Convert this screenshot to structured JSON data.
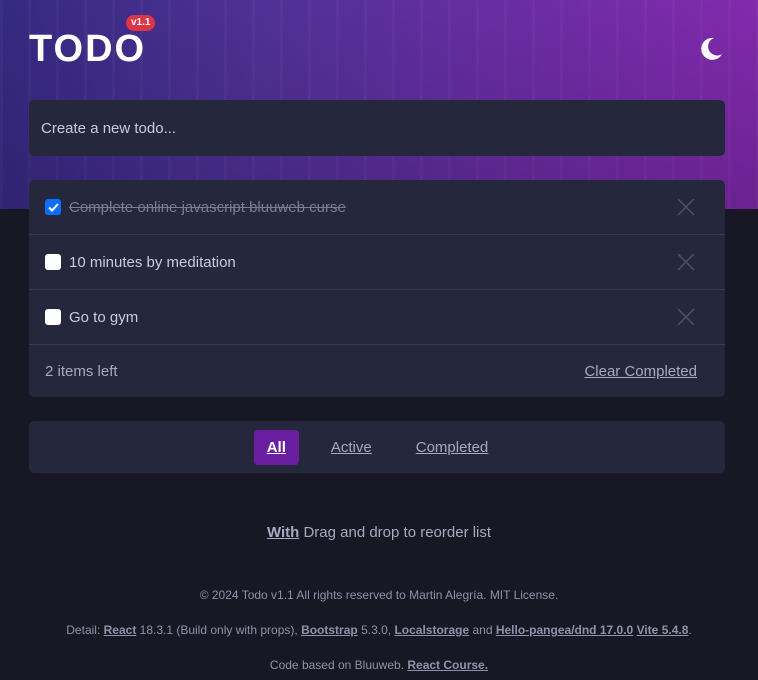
{
  "header": {
    "title": "TODO",
    "version_badge": "v1.1",
    "theme_icon": "moon-icon"
  },
  "new_todo": {
    "placeholder": "Create a new todo..."
  },
  "todos": [
    {
      "text": "Complete online javascript bluuweb curse",
      "completed": true
    },
    {
      "text": "10 minutes by meditation",
      "completed": false
    },
    {
      "text": "Go to gym",
      "completed": false
    }
  ],
  "list_footer": {
    "items_left": "2 items left",
    "clear_completed": "Clear Completed"
  },
  "filters": {
    "all": "All",
    "active": "Active",
    "completed": "Completed",
    "selected": "All"
  },
  "dnd_note": {
    "with": "With",
    "text": " Drag and drop to reorder list"
  },
  "footer": {
    "copyright": "© 2024 Todo v1.1 All rights reserved to Martin Alegría. MIT License.",
    "detail_label": "Detail: ",
    "react": "React",
    "react_version": " 18.3.1 (Build only with props), ",
    "bootstrap": "Bootstrap",
    "bootstrap_version": " 5.3.0, ",
    "localstorage": "Localstorage",
    "and": " and ",
    "dnd": "Hello-pangea/dnd 17.0.0",
    "vite": "Vite 5.4.8",
    "period": ".",
    "code_based": "Code based on Bluuweb. ",
    "react_course": "React Course."
  },
  "colors": {
    "accent": "#6a1fa0",
    "checkbox_checked": "#0d6efd",
    "card_bg": "#25273d",
    "page_bg": "#171823",
    "badge": "#dc3545"
  }
}
